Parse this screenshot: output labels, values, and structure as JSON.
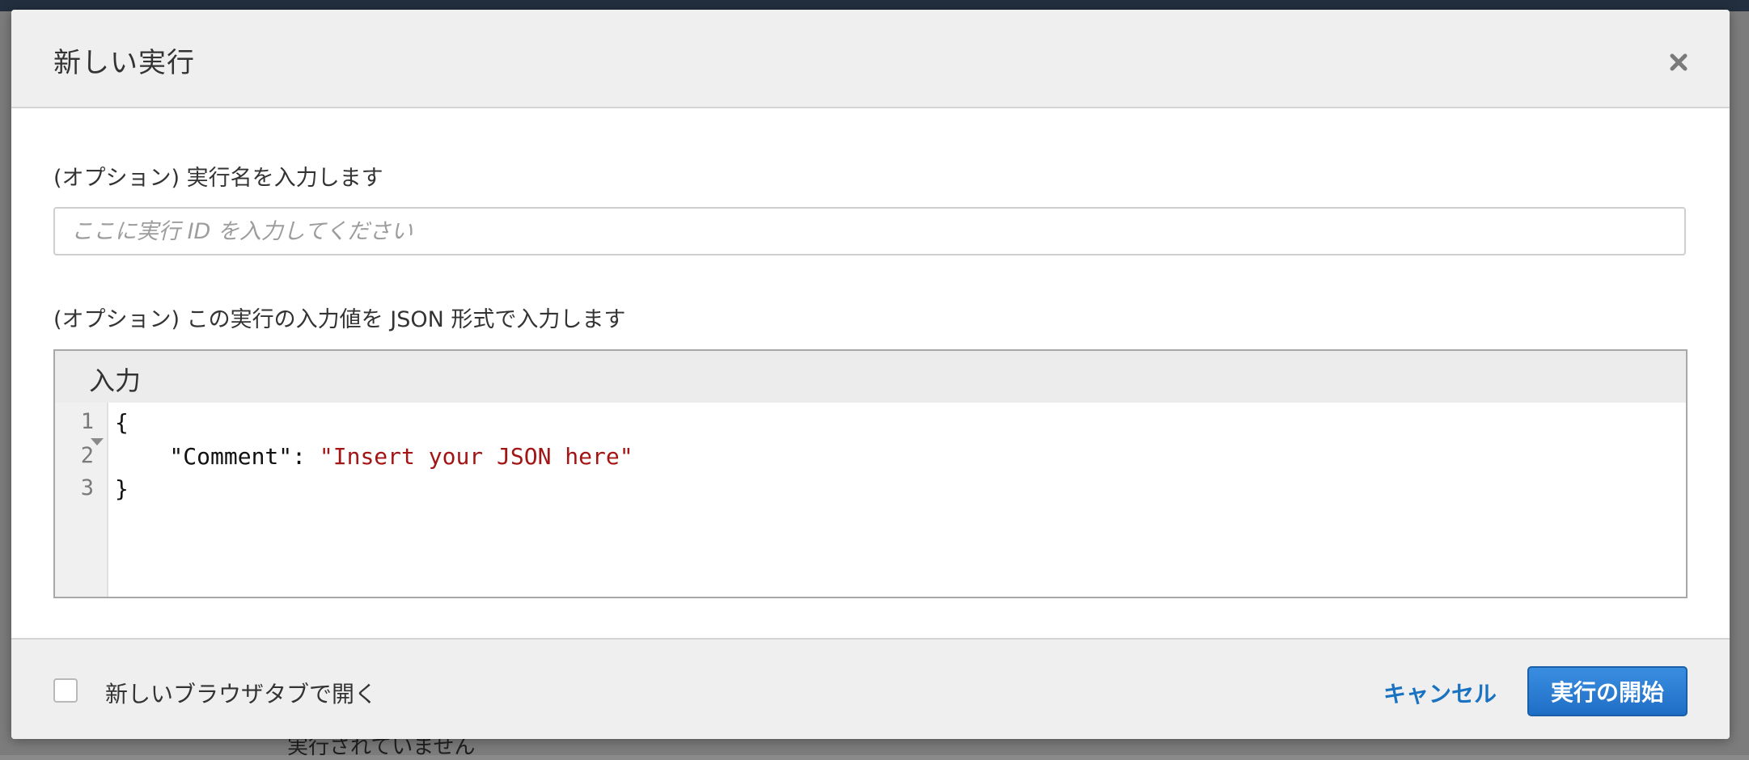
{
  "modal": {
    "title": "新しい実行",
    "name_label": "(オプション) 実行名を入力します",
    "name_placeholder": "ここに実行 ID を入力してください",
    "name_value": "",
    "json_label": "(オプション) この実行の入力値を JSON 形式で入力します",
    "editor": {
      "title": "入力",
      "line_numbers": [
        "1",
        "2",
        "3"
      ],
      "lines": {
        "open_brace": "{",
        "key": "    \"Comment\": ",
        "value": "\"Insert your JSON here\"",
        "close_brace": "}"
      }
    },
    "footer": {
      "checkbox_label": "新しいブラウザタブで開く",
      "checkbox_checked": false,
      "cancel_label": "キャンセル",
      "start_label": "実行の開始"
    }
  },
  "background": {
    "bottom_text": "実行されていません"
  },
  "colors": {
    "primary_button": "#1f6ec6",
    "link": "#1a73c0",
    "json_string": "#a31515"
  }
}
